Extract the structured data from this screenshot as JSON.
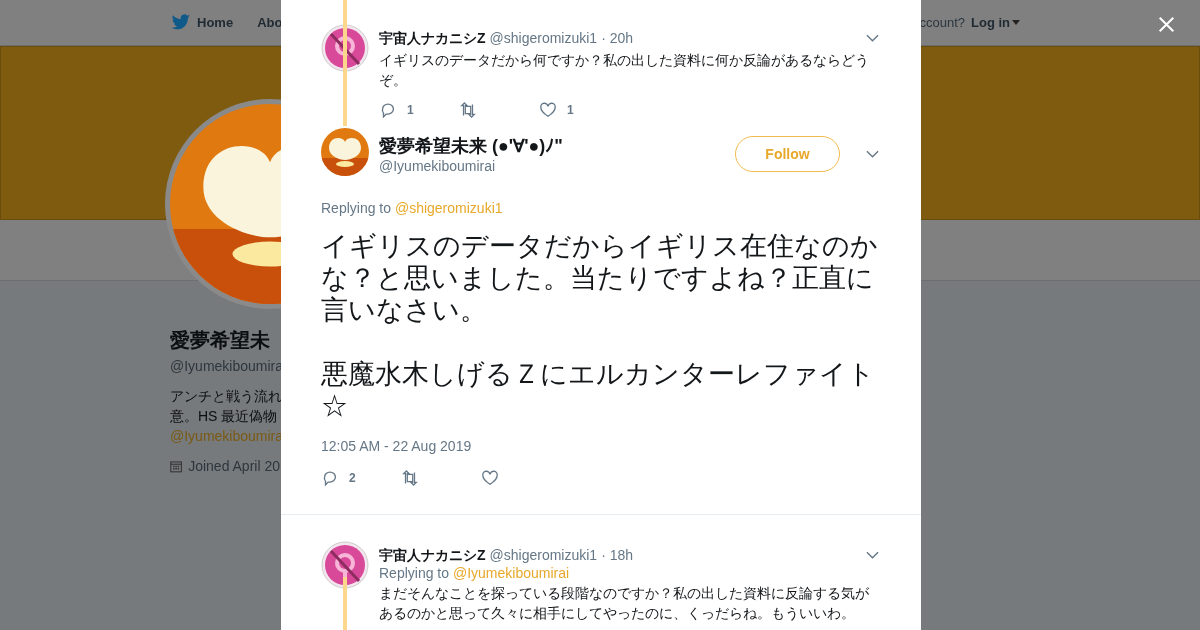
{
  "nav": {
    "home": "Home",
    "about": "Abo",
    "login_prompt": "ccount?",
    "login": "Log in"
  },
  "profile": {
    "name": "愛夢希望未",
    "handle": "@Iyumekiboumira",
    "bio_lines": [
      "アンチと戦う流れ",
      "意。HS 最近偽物"
    ],
    "bio_link": "@Iyumekiboumira",
    "joined": "Joined April 20"
  },
  "context_tweet": {
    "name": "宇宙人ナカニシZ",
    "handle": "@shigeromizuki1",
    "time": "· 20h",
    "text": "イギリスのデータだから何ですか？私の出した資料に何か反論があるならどうぞ。",
    "replies": "1",
    "likes": "1"
  },
  "main_tweet": {
    "name": "愛夢希望未来 (●'∀'●)ﾉ\"",
    "handle": "@Iyumekiboumirai",
    "follow": "Follow",
    "replying_label": "Replying to",
    "replying_to": "@shigeromizuki1",
    "paragraphs": [
      "イギリスのデータだからイギリス在住なのかな？と思いました。当たりですよね？正直に言いなさい。",
      "悪魔水木しげるＺにエルカンターレファイト☆"
    ],
    "timestamp": "12:05 AM - 22 Aug 2019",
    "replies": "2"
  },
  "reply_tweet": {
    "name": "宇宙人ナカニシZ",
    "handle": "@shigeromizuki1",
    "time": "· 18h",
    "replying_label": "Replying to",
    "replying_to": "@Iyumekiboumirai",
    "text": "まだそんなことを探っている段階なのですか？私の出した資料に反論する気があるのかと思って久々に相手にしてやったのに、くっだらね。もういいわ。"
  }
}
